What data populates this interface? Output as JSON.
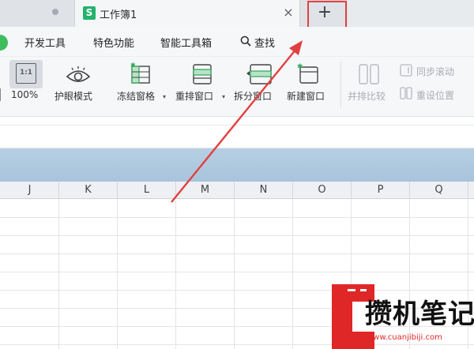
{
  "tabs": {
    "active_title": "工作簿1",
    "doc_icon_letter": "S",
    "close_symbol": "×",
    "new_tab_symbol": "+"
  },
  "menu": {
    "items": [
      "开发工具",
      "特色功能",
      "智能工具箱",
      "查找"
    ]
  },
  "ribbon": {
    "edge_label": "",
    "zoom_icon_text": "1:1",
    "zoom_label": "100%",
    "eye_label": "护眼模式",
    "freeze_label": "冻结窗格",
    "rearrange_label": "重排窗口",
    "split_label": "拆分窗口",
    "new_window_label": "新建窗口",
    "side_by_side_label": "并排比较",
    "sync_scroll_label": "同步滚动",
    "reset_position_label": "重设位置"
  },
  "sheet": {
    "columns": [
      "J",
      "K",
      "L",
      "M",
      "N",
      "O",
      "P",
      "Q"
    ]
  },
  "watermark": {
    "title": "攒机笔记",
    "url": "www.cuanjibiji.com"
  },
  "colors": {
    "annotation": "#e24040",
    "tab_icon": "#22b36c",
    "blue_band": "#b6cfe3"
  }
}
